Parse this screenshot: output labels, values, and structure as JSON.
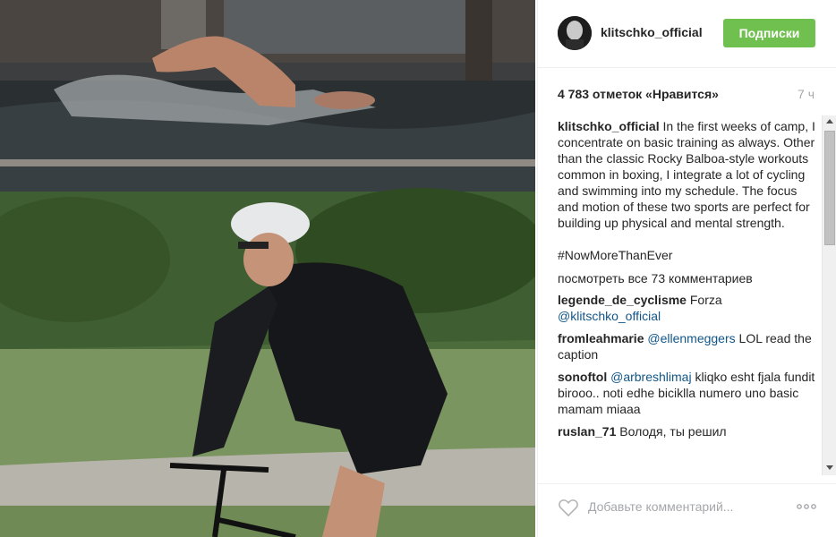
{
  "post": {
    "image_alt": "Swimming and cycling training photo collage"
  },
  "header": {
    "username": "klitschko_official",
    "follow_label": "Подписки"
  },
  "stats": {
    "likes": "4 783 отметок «Нравится»",
    "time": "7 ч"
  },
  "caption": {
    "username": "klitschko_official",
    "text": "In the first weeks of camp, I concentrate on basic training as always. Other than the classic Rocky Balboa-style workouts common in boxing, I integrate a lot of cycling and swimming into my schedule. The focus and motion of these two sports are perfect for building up physical and mental strength.",
    "hashtag": "#NowMoreThanEver"
  },
  "view_all_comments": "посмотреть все 73 комментариев",
  "comments": [
    {
      "username": "legende_de_cyclisme",
      "pre": "Forza ",
      "mention": "@klitschko_official",
      "post": ""
    },
    {
      "username": "fromleahmarie",
      "pre": "",
      "mention": "@ellenmeggers",
      "post": " LOL read the caption"
    },
    {
      "username": "sonoftol",
      "pre": "",
      "mention": "@arbreshlimaj",
      "post": " kliqko esht fjala fundit birooo.. noti edhe bicіklla numero uno basic mamam miaaa"
    },
    {
      "username": "ruslan_71",
      "pre": "Володя, ты решил",
      "mention": "",
      "post": ""
    }
  ],
  "comment_box": {
    "placeholder": "Добавьте комментарий..."
  },
  "icons": {
    "like": "heart-icon",
    "more": "more-options-icon",
    "scroll_up": "scroll-up-arrow-icon",
    "scroll_down": "scroll-down-arrow-icon"
  },
  "colors": {
    "follow_button": "#70c050",
    "link": "#125688",
    "muted": "#a5a7aa",
    "text": "#262626"
  }
}
